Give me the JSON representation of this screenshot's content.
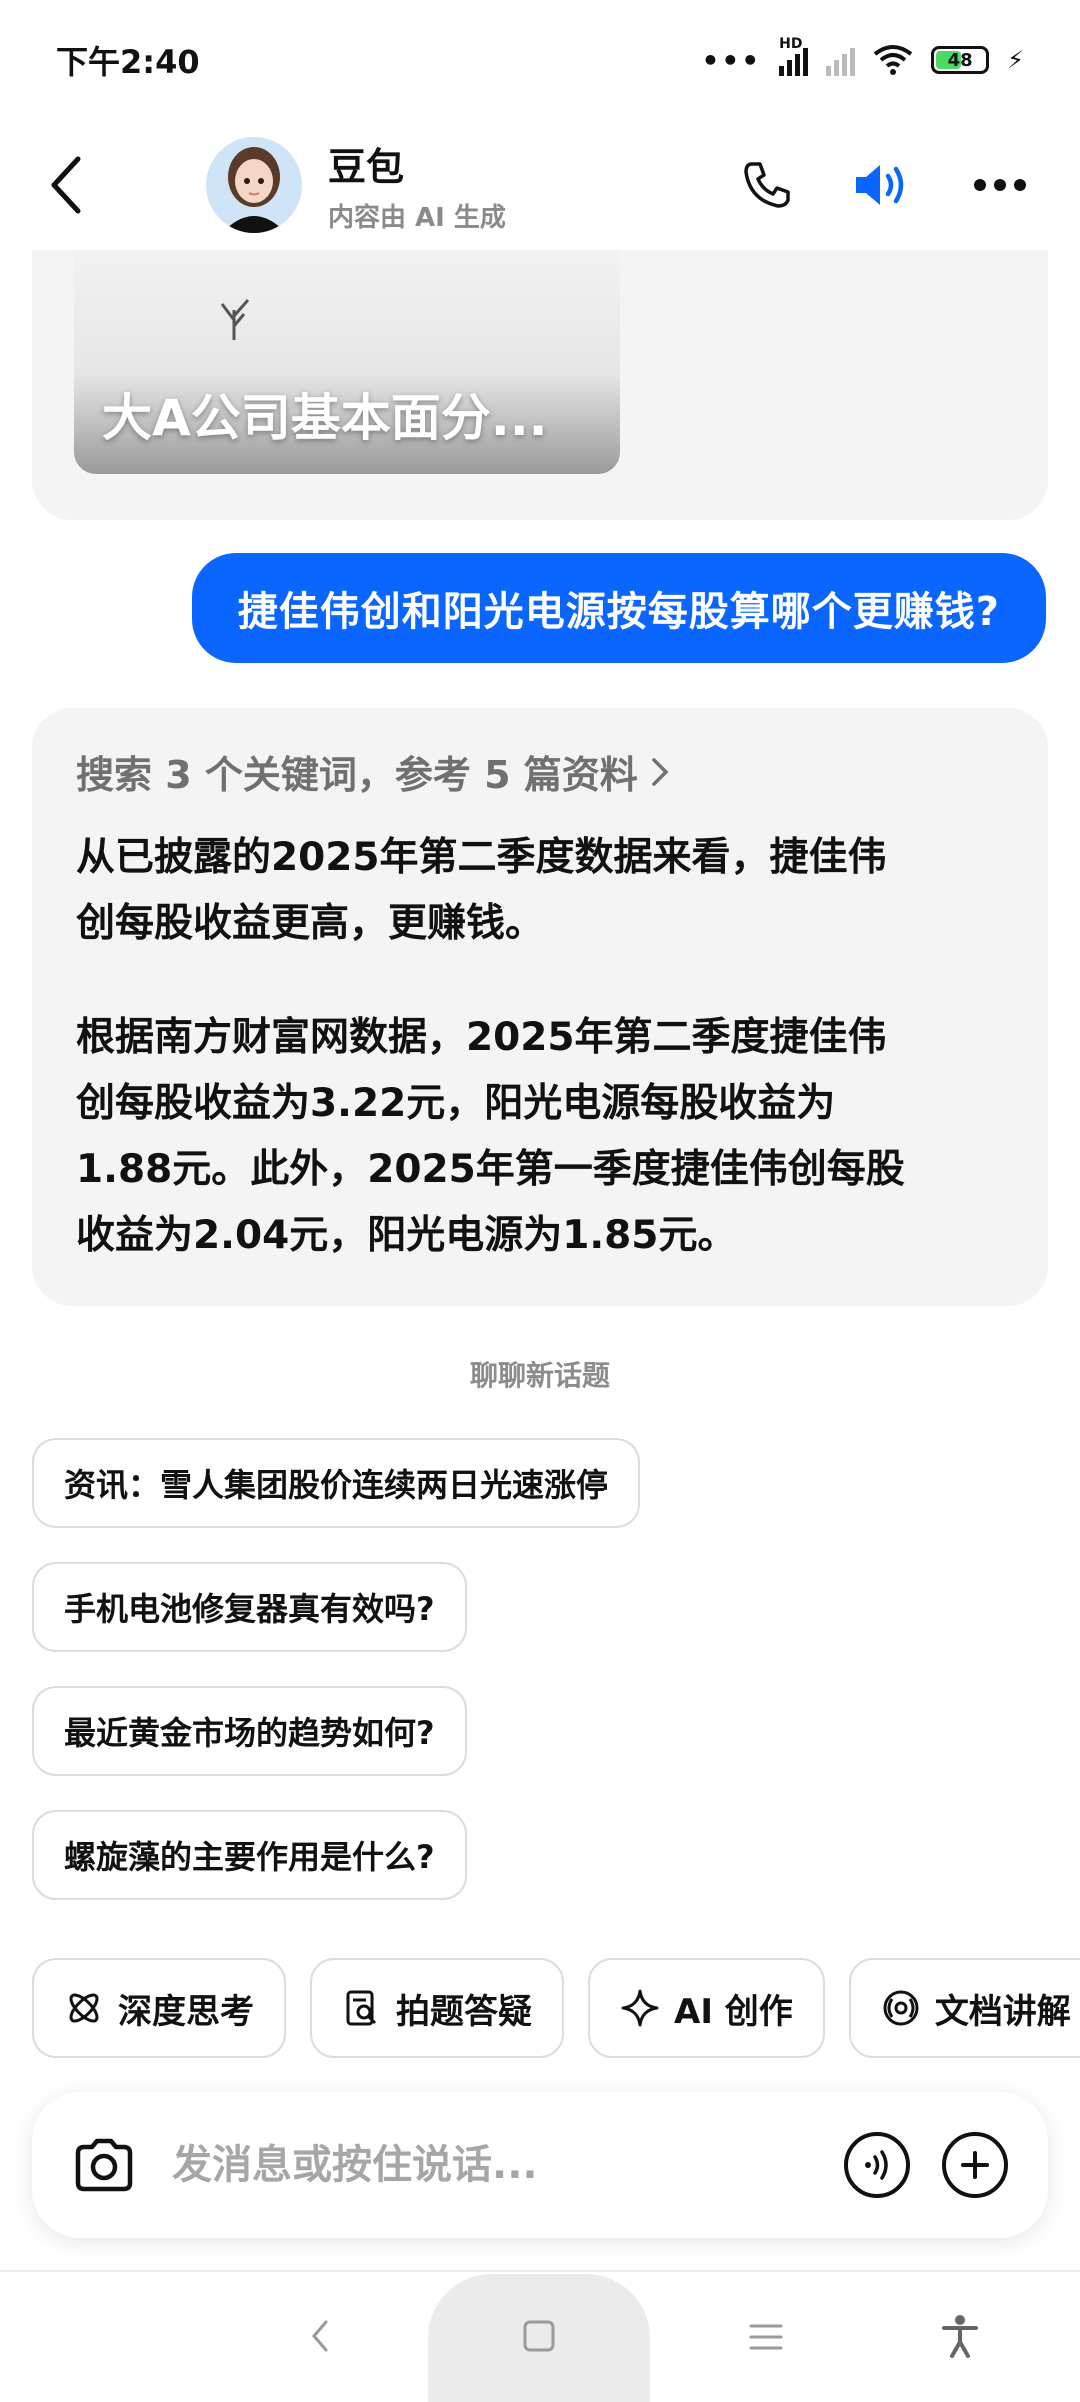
{
  "status_bar": {
    "time": "下午2:40",
    "battery": "48",
    "network_label": "HD"
  },
  "header": {
    "name": "豆包",
    "subtitle": "内容由 AI 生成"
  },
  "previous_card": {
    "title": "大A公司基本面分..."
  },
  "user_message": "捷佳伟创和阳光电源按每股算哪个更赚钱?",
  "answer": {
    "search_summary": "搜索 3 个关键词，参考 5 篇资料",
    "paragraph1_line1": "从已披露的2025年第二季度数据来看，捷佳伟",
    "paragraph1_line2": "创每股收益更高，更赚钱。",
    "paragraph2_line1": "根据南方财富网数据，2025年第二季度捷佳伟",
    "paragraph2_line2": "创每股收益为3.22元，阳光电源每股收益为",
    "paragraph2_line3": "1.88元。此外，2025年第一季度捷佳伟创每股",
    "paragraph2_line4": "收益为2.04元，阳光电源为1.85元。"
  },
  "new_topic_label": "聊聊新话题",
  "suggestions": [
    "资讯：雪人集团股价连续两日光速涨停",
    "手机电池修复器真有效吗?",
    "最近黄金市场的趋势如何?",
    "螺旋藻的主要作用是什么?"
  ],
  "tools": [
    {
      "label": "深度思考",
      "icon": "atom-icon"
    },
    {
      "label": "拍题答疑",
      "icon": "scan-doc-icon"
    },
    {
      "label": "AI 创作",
      "icon": "sparkle-icon"
    },
    {
      "label": "文档讲解",
      "icon": "broadcast-icon"
    }
  ],
  "input": {
    "placeholder": "发消息或按住说话..."
  },
  "colors": {
    "accent": "#0a66ff",
    "card_bg": "#f4f4f5"
  }
}
